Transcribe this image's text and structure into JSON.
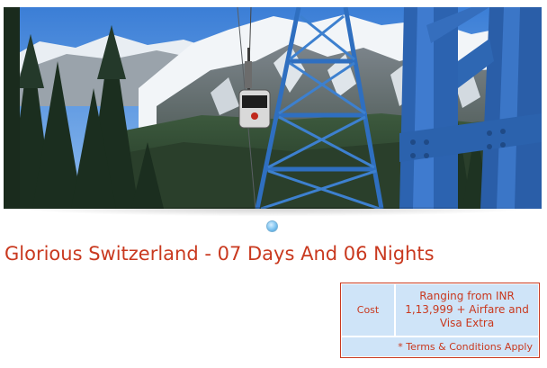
{
  "hero": {
    "image_subject": "cable car gondola with steel tower over snowy mountains"
  },
  "title": "Glorious Switzerland - 07 Days And 06 Nights",
  "cost": {
    "label": "Cost",
    "value": "Ranging from INR 1,13,999 + Airfare and Visa Extra",
    "terms": "* Terms & Conditions Apply"
  },
  "colors": {
    "accent": "#c9391f",
    "table_bg": "#cfe4f8",
    "pager": "#8ccbf3"
  }
}
